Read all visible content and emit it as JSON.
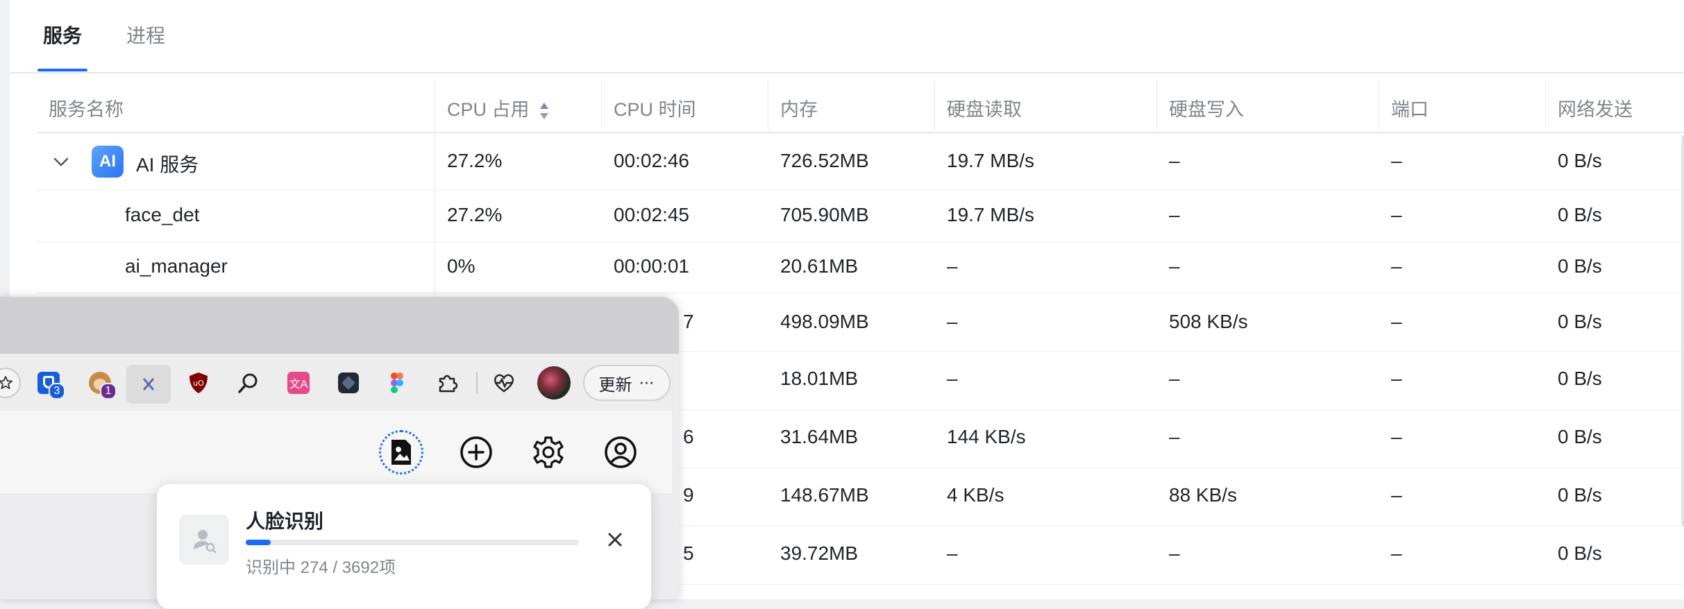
{
  "tabs": {
    "services": "服务",
    "processes": "进程"
  },
  "table": {
    "headers": {
      "name": "服务名称",
      "cpu": "CPU 占用",
      "cpu_time": "CPU 时间",
      "memory": "内存",
      "disk_read": "硬盘读取",
      "disk_write": "硬盘写入",
      "port": "端口",
      "net_send": "网络发送"
    },
    "group": {
      "name": "AI 服务",
      "icon": "ai-app-icon",
      "expanded": true
    },
    "rows": [
      {
        "name": "AI 服务",
        "cpu": "27.2%",
        "cpu_time": "00:02:46",
        "memory": "726.52MB",
        "disk_read": "19.7 MB/s",
        "disk_write": "–",
        "port": "–",
        "net_send": "0 B/s"
      },
      {
        "name": "face_det",
        "cpu": "27.2%",
        "cpu_time": "00:02:45",
        "memory": "705.90MB",
        "disk_read": "19.7 MB/s",
        "disk_write": "–",
        "port": "–",
        "net_send": "0 B/s"
      },
      {
        "name": "ai_manager",
        "cpu": "0%",
        "cpu_time": "00:00:01",
        "memory": "20.61MB",
        "disk_read": "–",
        "disk_write": "–",
        "port": "–",
        "net_send": "0 B/s"
      },
      {
        "cpu_time_fragment": "7",
        "memory": "498.09MB",
        "disk_read": "–",
        "disk_write": "508 KB/s",
        "port": "–",
        "net_send": "0 B/s"
      },
      {
        "memory": "18.01MB",
        "disk_read": "–",
        "disk_write": "–",
        "port": "–",
        "net_send": "0 B/s"
      },
      {
        "cpu_time_fragment": "6",
        "memory": "31.64MB",
        "disk_read": "144 KB/s",
        "disk_write": "–",
        "port": "–",
        "net_send": "0 B/s"
      },
      {
        "cpu_time_fragment": "9",
        "memory": "148.67MB",
        "disk_read": "4 KB/s",
        "disk_write": "88 KB/s",
        "port": "–",
        "net_send": "0 B/s"
      },
      {
        "cpu_time_fragment": "5",
        "memory": "39.72MB",
        "disk_read": "–",
        "disk_write": "–",
        "port": "–",
        "net_send": "0 B/s"
      }
    ]
  },
  "browser": {
    "extensions": [
      {
        "icon": "star-icon"
      },
      {
        "icon": "bitwarden-icon",
        "badge": "3"
      },
      {
        "icon": "tampermonkey-icon",
        "badge": "1"
      },
      {
        "icon": "x-extension-icon"
      },
      {
        "icon": "ublock-icon"
      },
      {
        "icon": "search-icon"
      },
      {
        "icon": "translate-icon"
      },
      {
        "icon": "dark-cube-icon"
      },
      {
        "icon": "figma-icon"
      },
      {
        "icon": "puzzle-icon"
      },
      {
        "icon": "health-icon"
      },
      {
        "icon": "profile-avatar-icon"
      }
    ],
    "update_label": "更新",
    "app_icons": [
      "photo-upload-icon",
      "add-icon",
      "settings-icon",
      "account-icon"
    ]
  },
  "popup": {
    "title": "人脸识别",
    "status": "识别中 274 / 3692项",
    "progress_current": 274,
    "progress_total": 3692
  },
  "colors": {
    "accent": "#1a6cf3",
    "ai_icon": "#3d8bff",
    "muted_text": "#80858c"
  }
}
